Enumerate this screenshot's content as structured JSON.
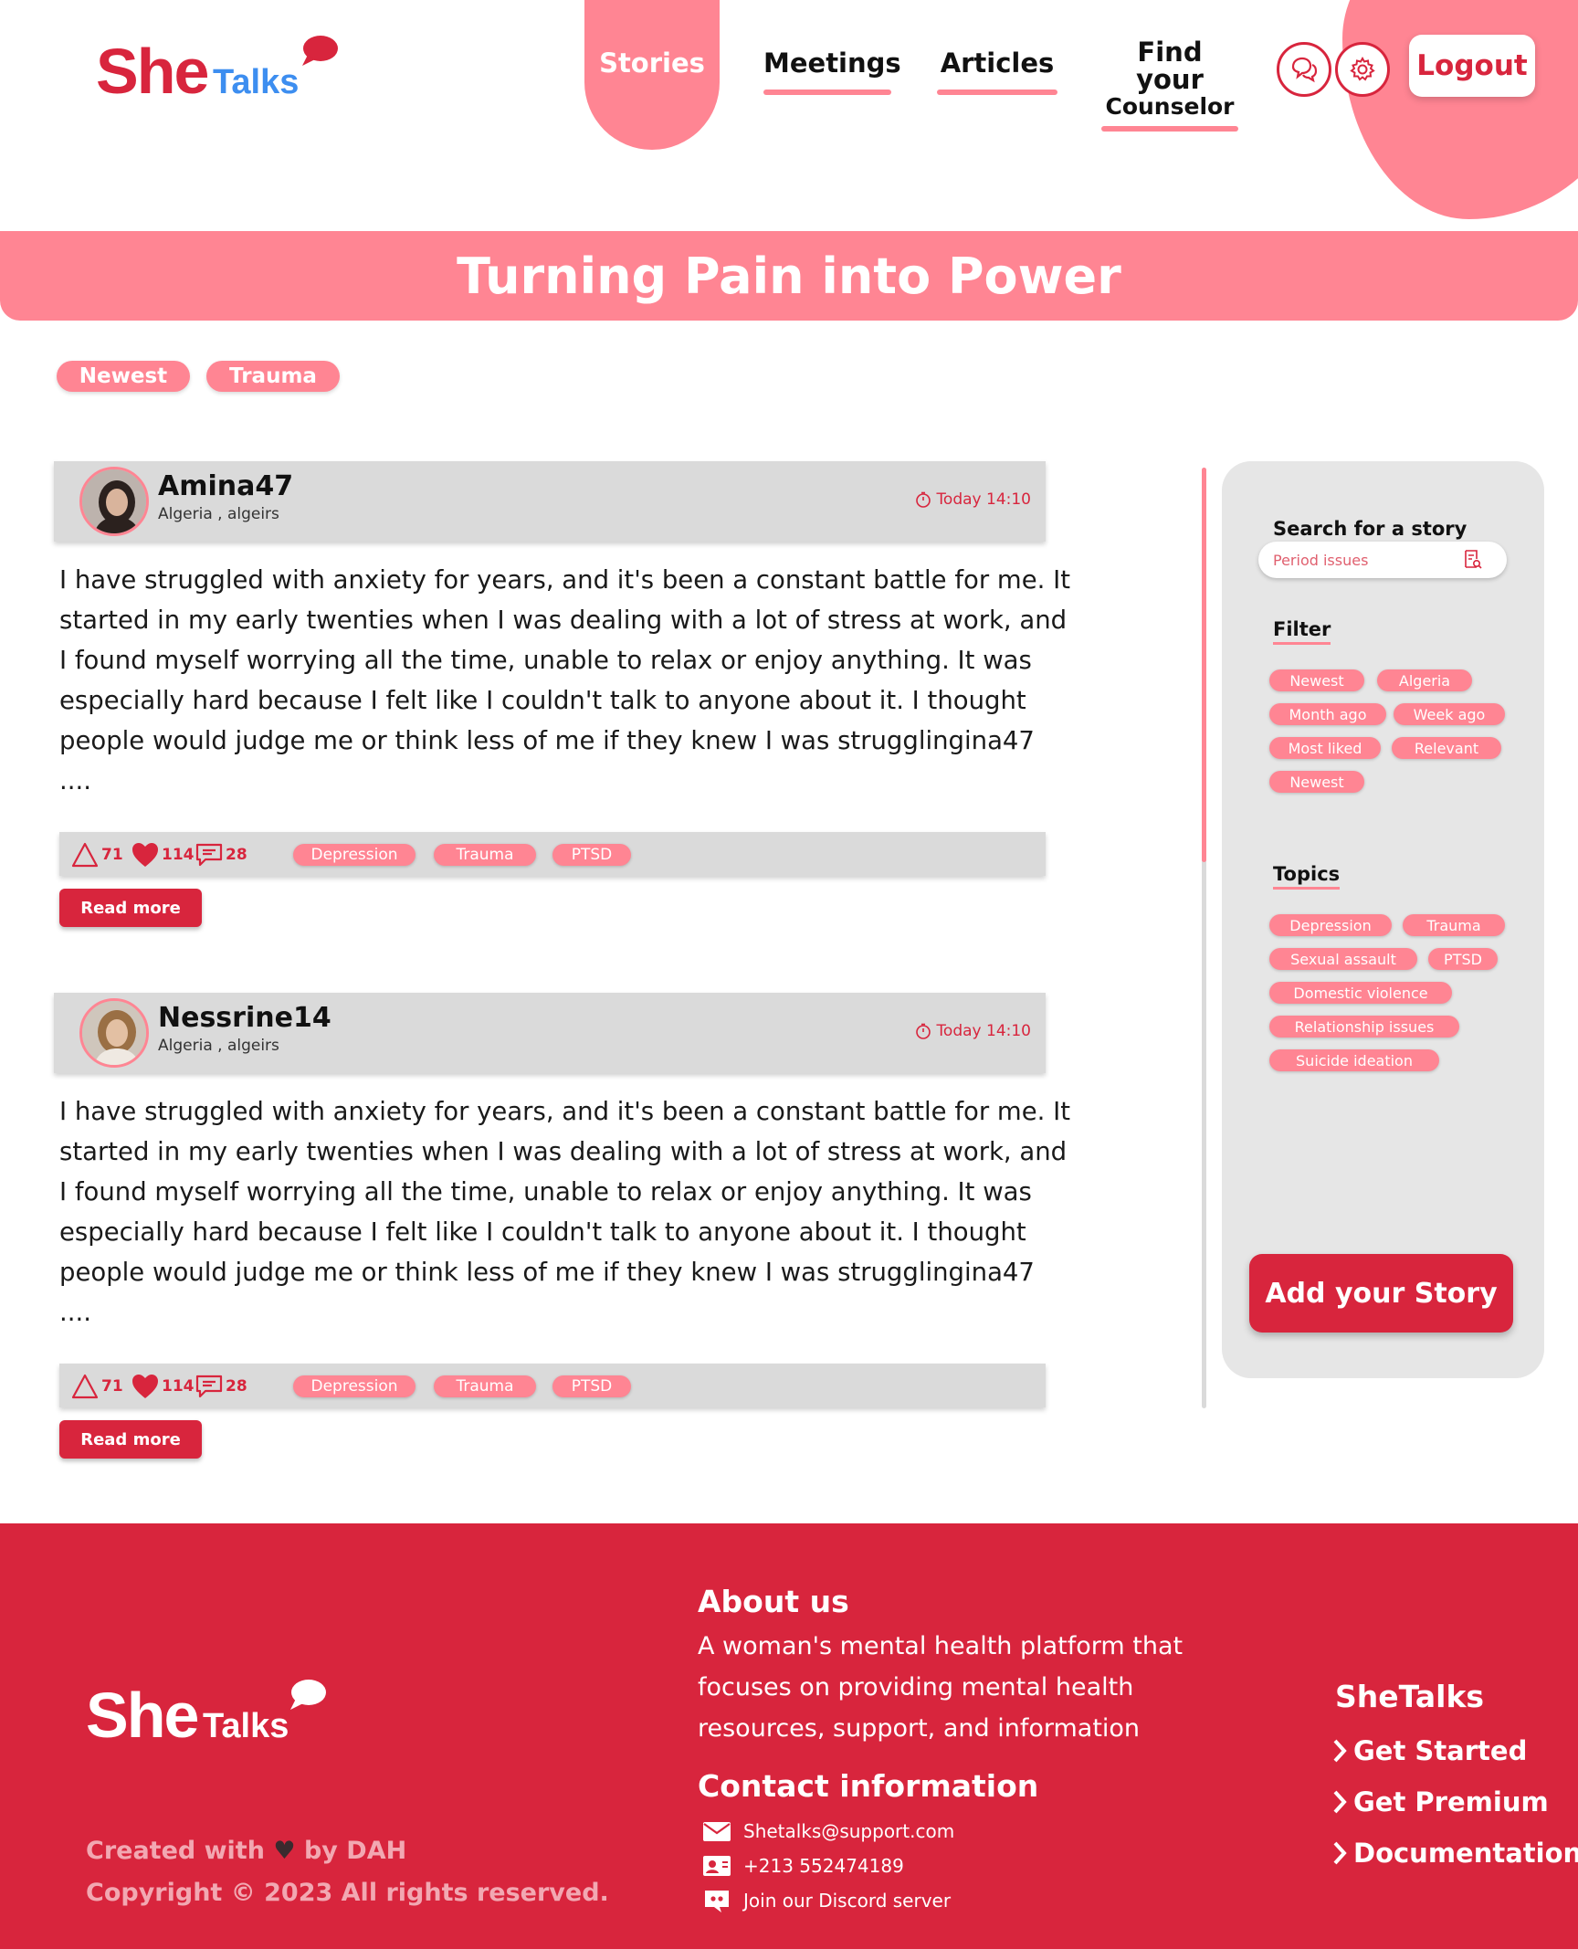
{
  "header": {
    "logo": {
      "she": "She",
      "talks": "Talks"
    },
    "nav": [
      {
        "label": "Stories"
      },
      {
        "label": "Meetings"
      },
      {
        "label": "Articles"
      },
      {
        "label_line1": "Find your",
        "label_line2": "Counselor"
      }
    ],
    "logout_label": "Logout",
    "icons": [
      "chat-icon",
      "settings-gear-icon"
    ]
  },
  "banner": {
    "title": "Turning Pain into Power"
  },
  "active_chips": [
    "Newest",
    "Trauma"
  ],
  "stories": [
    {
      "author": "Amina47",
      "location": "Algeria , algeirs",
      "time": "Today 14:10",
      "text": "I have struggled with anxiety for years, and it's been a constant battle for me. It started in my early twenties when I was dealing with a lot of stress at work, and I found myself worrying all the time, unable to relax or enjoy anything. It was especially hard because I felt like I couldn't talk to anyone about it. I thought people would judge me or think less of me if they knew I was strugglingina47 ....",
      "support_count": "71",
      "like_count": "114",
      "comment_count": "28",
      "tags": [
        "Depression",
        "Trauma",
        "PTSD"
      ],
      "read_more": "Read more"
    },
    {
      "author": "Nessrine14",
      "location": "Algeria , algeirs",
      "time": "Today 14:10",
      "text": "I have struggled with anxiety for years, and it's been a constant battle for me. It started in my early twenties when I was dealing with a lot of stress at work, and I found myself worrying all the time, unable to relax or enjoy anything. It was especially hard because I felt like I couldn't talk to anyone about it. I thought people would judge me or think less of me if they knew I was strugglingina47 ....",
      "support_count": "71",
      "like_count": "114",
      "comment_count": "28",
      "tags": [
        "Depression",
        "Trauma",
        "PTSD"
      ],
      "read_more": "Read more"
    }
  ],
  "sidebar": {
    "search_label": "Search for a story",
    "search_placeholder": "Period issues",
    "filter_label": "Filter",
    "filters": [
      "Newest",
      "Algeria",
      "Month ago",
      "Week ago",
      "Most liked",
      "Relevant",
      "Newest"
    ],
    "topics_label": "Topics",
    "topics": [
      "Depression",
      "Trauma",
      "Sexual assault",
      "PTSD",
      "Domestic violence",
      "Relationship issues",
      "Suicide ideation"
    ],
    "add_story": "Add your Story"
  },
  "footer": {
    "logo": {
      "she": "She",
      "talks": "Talks"
    },
    "created_with": "Created with",
    "created_by": "by DAH",
    "copyright": "Copyright © 2023 All rights reserved.",
    "about_title": "About us",
    "about_text": "A woman's mental health platform that focuses on providing mental health resources, support, and information",
    "contact_title": "Contact information",
    "email": "Shetalks@support.com",
    "phone": "+213 552474189",
    "discord": "Join our Discord server",
    "links_title": "SheTalks",
    "links": [
      "Get Started",
      "Get Premium",
      "Documentation"
    ]
  },
  "colors": {
    "primary": "#d8253d",
    "accent": "#ff8593",
    "panel": "#e6e6e6",
    "card": "#dadada",
    "logo_talks": "#3d8ef0"
  }
}
